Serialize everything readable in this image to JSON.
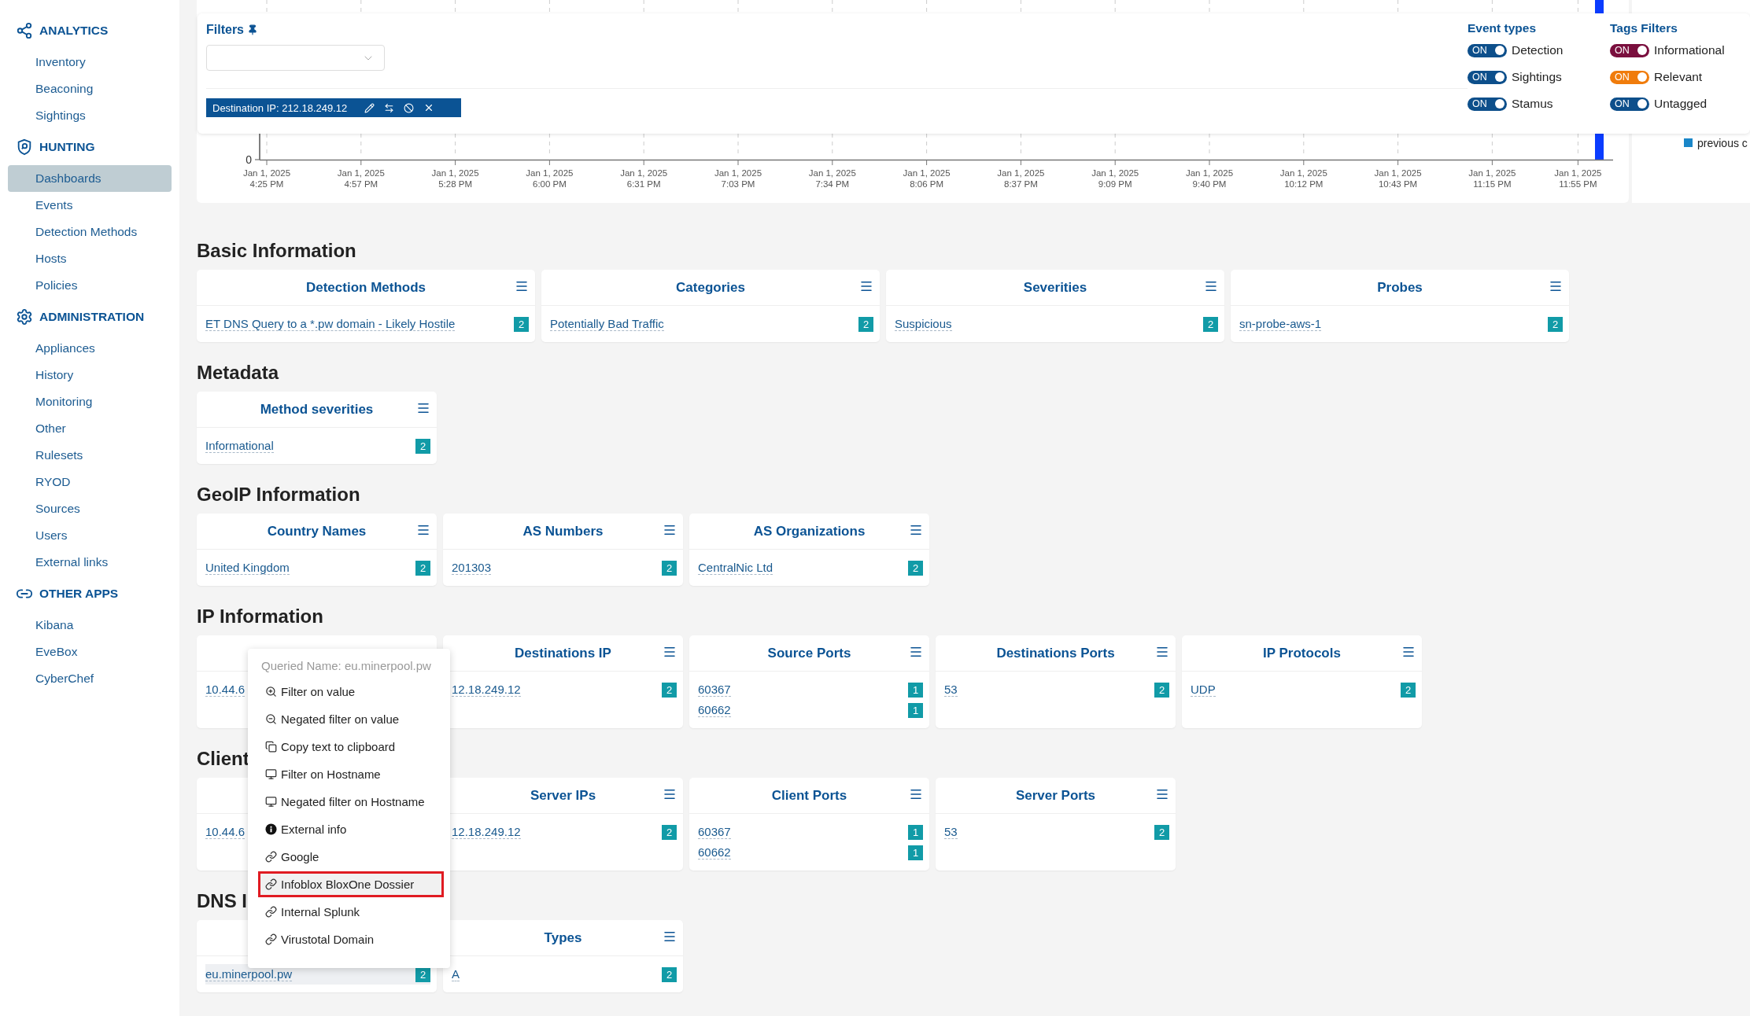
{
  "sidebar": {
    "groups": [
      {
        "title": "ANALYTICS",
        "kind": "share",
        "items": [
          {
            "label": "Inventory",
            "selected": false
          },
          {
            "label": "Beaconing",
            "selected": false
          },
          {
            "label": "Sightings",
            "selected": false
          }
        ]
      },
      {
        "title": "HUNTING",
        "kind": "shield",
        "items": [
          {
            "label": "Dashboards",
            "selected": true
          },
          {
            "label": "Events",
            "selected": false
          },
          {
            "label": "Detection Methods",
            "selected": false
          },
          {
            "label": "Hosts",
            "selected": false
          },
          {
            "label": "Policies",
            "selected": false
          }
        ]
      },
      {
        "title": "ADMINISTRATION",
        "kind": "gear",
        "items": [
          {
            "label": "Appliances",
            "selected": false
          },
          {
            "label": "History",
            "selected": false
          },
          {
            "label": "Monitoring",
            "selected": false
          },
          {
            "label": "Other",
            "selected": false
          },
          {
            "label": "Rulesets",
            "selected": false
          },
          {
            "label": "RYOD",
            "selected": false
          },
          {
            "label": "Sources",
            "selected": false
          },
          {
            "label": "Users",
            "selected": false
          },
          {
            "label": "External links",
            "selected": false
          }
        ]
      },
      {
        "title": "OTHER APPS",
        "kind": "link",
        "items": [
          {
            "label": "Kibana",
            "selected": false
          },
          {
            "label": "EveBox",
            "selected": false
          },
          {
            "label": "CyberChef",
            "selected": false
          }
        ]
      }
    ]
  },
  "timeline": {
    "y_tick": "0",
    "legend": "previous c",
    "x_ticks": [
      {
        "date": "Jan 1, 2025",
        "time": "4:25 PM"
      },
      {
        "date": "Jan 1, 2025",
        "time": "4:57 PM"
      },
      {
        "date": "Jan 1, 2025",
        "time": "5:28 PM"
      },
      {
        "date": "Jan 1, 2025",
        "time": "6:00 PM"
      },
      {
        "date": "Jan 1, 2025",
        "time": "6:31 PM"
      },
      {
        "date": "Jan 1, 2025",
        "time": "7:03 PM"
      },
      {
        "date": "Jan 1, 2025",
        "time": "7:34 PM"
      },
      {
        "date": "Jan 1, 2025",
        "time": "8:06 PM"
      },
      {
        "date": "Jan 1, 2025",
        "time": "8:37 PM"
      },
      {
        "date": "Jan 1, 2025",
        "time": "9:09 PM"
      },
      {
        "date": "Jan 1, 2025",
        "time": "9:40 PM"
      },
      {
        "date": "Jan 1, 2025",
        "time": "10:12 PM"
      },
      {
        "date": "Jan 1, 2025",
        "time": "10:43 PM"
      },
      {
        "date": "Jan 1, 2025",
        "time": "11:15 PM"
      },
      {
        "date": "Jan 1, 2025",
        "time": "11:55 PM"
      }
    ]
  },
  "filters": {
    "title": "Filters",
    "chip": {
      "label": "Destination IP: 212.18.249.12"
    },
    "event_types": {
      "title": "Event types",
      "toggles": [
        {
          "text": "ON",
          "label": "Detection",
          "on": true,
          "color": "#0d4f8b"
        },
        {
          "text": "ON",
          "label": "Sightings",
          "on": true,
          "color": "#0d4f8b"
        },
        {
          "text": "ON",
          "label": "Stamus",
          "on": true,
          "color": "#0d4f8b"
        }
      ]
    },
    "tags_filters": {
      "title": "Tags Filters",
      "toggles": [
        {
          "text": "ON",
          "label": "Informational",
          "on": true,
          "color": "#7a0f3e"
        },
        {
          "text": "ON",
          "label": "Relevant",
          "on": true,
          "color": "#f07c0c"
        },
        {
          "text": "ON",
          "label": "Untagged",
          "on": true,
          "color": "#0d4f8b"
        }
      ]
    }
  },
  "sections": [
    {
      "title": "Basic Information",
      "kind": "wide",
      "cards": [
        {
          "title": "Detection Methods",
          "rows": [
            {
              "value": "ET DNS Query to a *.pw domain - Likely Hostile",
              "count": "2",
              "highlighted": false
            }
          ]
        },
        {
          "title": "Categories",
          "rows": [
            {
              "value": "Potentially Bad Traffic",
              "count": "2",
              "highlighted": false
            }
          ]
        },
        {
          "title": "Severities",
          "rows": [
            {
              "value": "Suspicious",
              "count": "2",
              "highlighted": false
            }
          ]
        },
        {
          "title": "Probes",
          "rows": [
            {
              "value": "sn-probe-aws-1",
              "count": "2",
              "highlighted": false
            }
          ]
        }
      ]
    },
    {
      "title": "Metadata",
      "kind": "narrow",
      "cards": [
        {
          "title": "Method severities",
          "rows": [
            {
              "value": "Informational",
              "count": "2",
              "highlighted": false
            }
          ]
        }
      ]
    },
    {
      "title": "GeoIP Information",
      "kind": "narrow",
      "cards": [
        {
          "title": "Country Names",
          "rows": [
            {
              "value": "United Kingdom",
              "count": "2",
              "highlighted": false
            }
          ]
        },
        {
          "title": "AS Numbers",
          "rows": [
            {
              "value": "201303",
              "count": "2",
              "highlighted": false
            }
          ]
        },
        {
          "title": "AS Organizations",
          "rows": [
            {
              "value": "CentralNic Ltd",
              "count": "2",
              "highlighted": false
            }
          ]
        }
      ]
    },
    {
      "title": "IP Information",
      "kind": "narrow",
      "cards": [
        {
          "rows": [
            {
              "value": "10.44.6",
              "highlighted": false
            }
          ]
        },
        {
          "title": "Destinations IP",
          "rows": [
            {
              "value": "12.18.249.12",
              "count": "2",
              "highlighted": false
            }
          ]
        },
        {
          "title": "Source Ports",
          "rows": [
            {
              "value": "60367",
              "count": "1",
              "highlighted": false
            },
            {
              "value": "60662",
              "count": "1",
              "highlighted": false
            }
          ]
        },
        {
          "title": "Destinations Ports",
          "rows": [
            {
              "value": "53",
              "count": "2",
              "highlighted": false
            }
          ]
        },
        {
          "title": "IP Protocols",
          "rows": [
            {
              "value": "UDP",
              "count": "2",
              "highlighted": false
            }
          ]
        }
      ]
    },
    {
      "title": "Client",
      "kind": "narrow",
      "cards": [
        {
          "rows": [
            {
              "value": "10.44.6",
              "highlighted": false
            }
          ]
        },
        {
          "title": "Server IPs",
          "rows": [
            {
              "value": "12.18.249.12",
              "count": "2",
              "highlighted": false
            }
          ]
        },
        {
          "title": "Client Ports",
          "rows": [
            {
              "value": "60367",
              "count": "1",
              "highlighted": false
            },
            {
              "value": "60662",
              "count": "1",
              "highlighted": false
            }
          ]
        },
        {
          "title": "Server Ports",
          "rows": [
            {
              "value": "53",
              "count": "2",
              "highlighted": false
            }
          ]
        }
      ]
    },
    {
      "title": "DNS I",
      "kind": "narrow",
      "cards": [
        {
          "rows": [
            {
              "value": "eu.minerpool.pw",
              "count": "2",
              "highlighted": true
            }
          ]
        },
        {
          "title": "Types",
          "rows": [
            {
              "value": "A",
              "count": "2",
              "highlighted": false
            }
          ]
        }
      ]
    }
  ],
  "context_menu": {
    "header": "Queried Name: eu.minerpool.pw",
    "items": [
      {
        "kind": "zoom-in",
        "label": "Filter on value",
        "selected": false
      },
      {
        "kind": "zoom-out",
        "label": "Negated filter on value",
        "selected": false
      },
      {
        "kind": "copy",
        "label": "Copy text to clipboard",
        "selected": false
      },
      {
        "kind": "monitor",
        "label": "Filter on Hostname",
        "selected": false
      },
      {
        "kind": "monitor",
        "label": "Negated filter on Hostname",
        "selected": false
      },
      {
        "kind": "info",
        "label": "External info",
        "selected": false
      },
      {
        "kind": "link",
        "label": "Google",
        "selected": false
      },
      {
        "kind": "link",
        "label": "Infoblox BloxOne Dossier",
        "selected": true
      },
      {
        "kind": "link",
        "label": "Internal Splunk",
        "selected": false
      },
      {
        "kind": "link",
        "label": "Virustotal Domain",
        "selected": false
      }
    ]
  }
}
